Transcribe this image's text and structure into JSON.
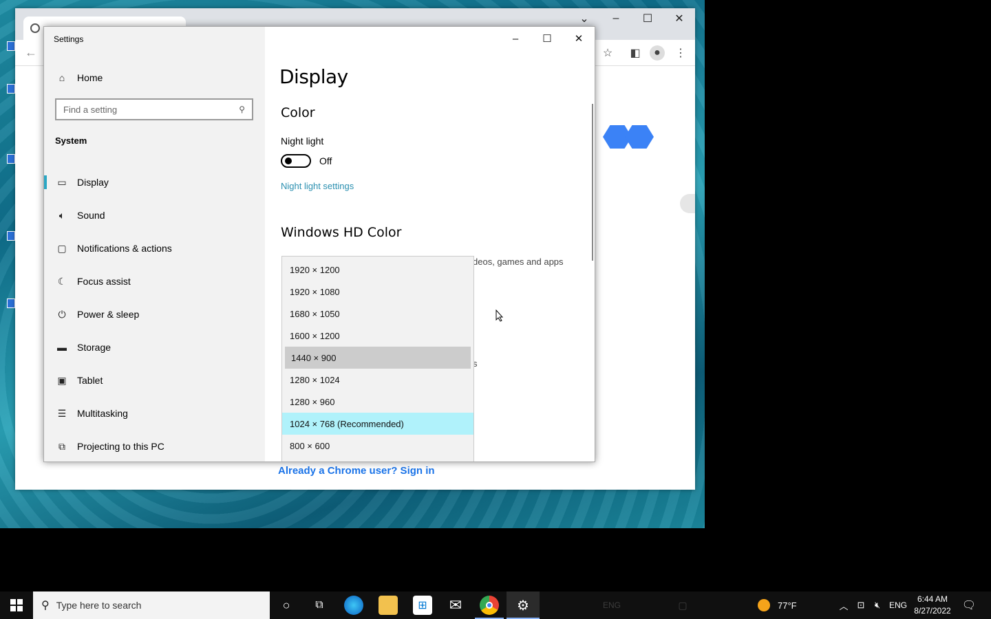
{
  "settings": {
    "window_title": "Settings",
    "home": "Home",
    "search_placeholder": "Find a setting",
    "section": "System",
    "nav": [
      {
        "label": "Display",
        "icon": "monitor-icon"
      },
      {
        "label": "Sound",
        "icon": "speaker-icon"
      },
      {
        "label": "Notifications & actions",
        "icon": "notification-icon"
      },
      {
        "label": "Focus assist",
        "icon": "moon-icon"
      },
      {
        "label": "Power & sleep",
        "icon": "power-icon"
      },
      {
        "label": "Storage",
        "icon": "storage-icon"
      },
      {
        "label": "Tablet",
        "icon": "tablet-icon"
      },
      {
        "label": "Multitasking",
        "icon": "multitasking-icon"
      },
      {
        "label": "Projecting to this PC",
        "icon": "projector-icon"
      }
    ],
    "main": {
      "title": "Display",
      "color_heading": "Color",
      "night_light_label": "Night light",
      "night_light_state": "Off",
      "night_light_link": "Night light settings",
      "hd_color_heading": "Windows HD Color",
      "hd_color_desc_partial": "deos, games and apps",
      "partial_s": "s"
    },
    "resolution_options": [
      "1920 × 1200",
      "1920 × 1080",
      "1680 × 1050",
      "1600 × 1200",
      "1440 × 900",
      "1280 × 1024",
      "1280 × 960",
      "1024 × 768 (Recommended)",
      "800 × 600"
    ],
    "hovered_option": "1440 × 900",
    "selected_option": "1024 × 768 (Recommended)"
  },
  "chrome": {
    "signin_link": "Already a Chrome user? Sign in"
  },
  "taskbar": {
    "search_placeholder": "Type here to search",
    "weather": "77°F",
    "language": "ENG",
    "time": "6:44 AM",
    "date": "8/27/2022"
  },
  "colors": {
    "accent": "#2aa7c4",
    "link": "#2a8fb0",
    "selected_bg": "#b0f2fb",
    "chrome_link": "#1a73e8"
  }
}
